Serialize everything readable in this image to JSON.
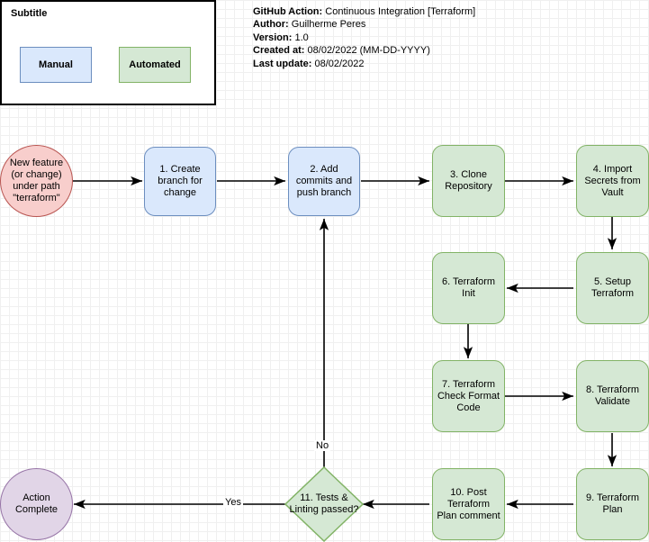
{
  "legend": {
    "title": "Subtitle",
    "manual_label": "Manual",
    "automated_label": "Automated",
    "manual_fill": "#dae8fc",
    "manual_stroke": "#6c8ebf",
    "automated_fill": "#d5e8d4",
    "automated_stroke": "#82b366"
  },
  "meta": {
    "action_key": "GitHub Action:",
    "action_value": "Continuous Integration [Terraform]",
    "author_key": "Author:",
    "author_value": "Guilherme Peres",
    "version_key": "Version:",
    "version_value": "1.0",
    "created_key": "Created at:",
    "created_value": "08/02/2022 (MM-DD-YYYY)",
    "updated_key": "Last update:",
    "updated_value": "08/02/2022"
  },
  "nodes": {
    "start": "New feature (or change) under path \"terraform\"",
    "n1": "1. Create branch for change",
    "n2": "2. Add commits and push branch",
    "n3": "3. Clone Repository",
    "n4": "4. Import Secrets from Vault",
    "n5": "5. Setup Terraform",
    "n6": "6. Terraform Init",
    "n7": "7. Terraform Check Format Code",
    "n8": "8. Terraform Validate",
    "n9": "9. Terraform Plan",
    "n10": "10. Post Terraform Plan comment",
    "n11": "11. Tests & Linting passed?",
    "end": "Action Complete"
  },
  "edge_labels": {
    "no": "No",
    "yes": "Yes"
  },
  "colors": {
    "manual_fill": "#dae8fc",
    "manual_stroke": "#6c8ebf",
    "automated_fill": "#d5e8d4",
    "automated_stroke": "#82b366",
    "start_fill": "#f8cecc",
    "start_stroke": "#b85450",
    "end_fill": "#e1d5e7",
    "end_stroke": "#9673a6",
    "edge": "#000000"
  }
}
